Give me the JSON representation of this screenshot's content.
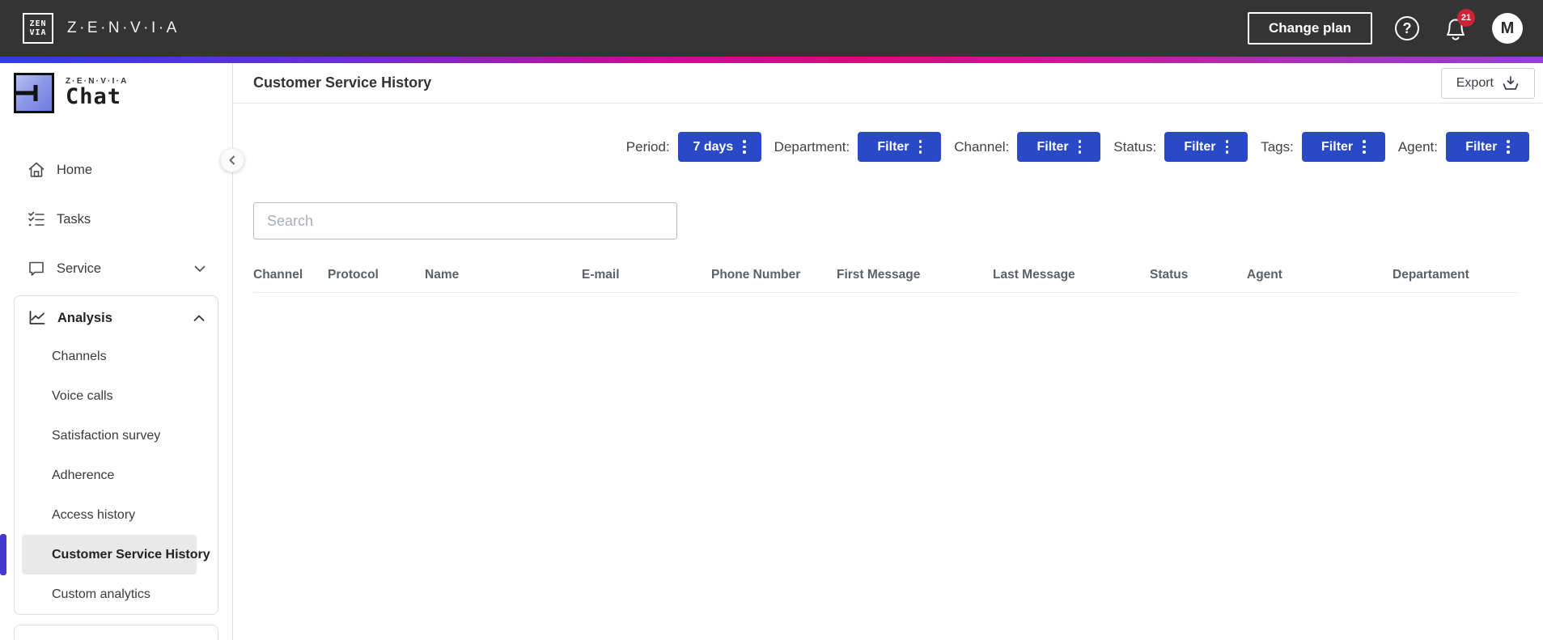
{
  "topbar": {
    "brand": "Z·E·N·V·I·A",
    "logo_glyph_top": "ZEN",
    "logo_glyph_bottom": "VIA",
    "change_plan_label": "Change plan",
    "help_glyph": "?",
    "notification_count": "21",
    "avatar_initial": "M"
  },
  "sidebar": {
    "logo": {
      "brand_small": "Z·E·N·V·I·A",
      "product": "Chat"
    },
    "items": [
      {
        "label": "Home"
      },
      {
        "label": "Tasks"
      },
      {
        "label": "Service"
      }
    ],
    "analysis": {
      "label": "Analysis",
      "items": [
        {
          "label": "Channels"
        },
        {
          "label": "Voice calls"
        },
        {
          "label": "Satisfaction survey"
        },
        {
          "label": "Adherence"
        },
        {
          "label": "Access history"
        },
        {
          "label": "Customer Service History"
        },
        {
          "label": "Custom analytics"
        }
      ],
      "active_item": "Customer Service History"
    }
  },
  "main": {
    "title": "Customer Service History",
    "export_label": "Export",
    "filters": [
      {
        "label": "Period:",
        "value": "7 days"
      },
      {
        "label": "Department:",
        "value": "Filter"
      },
      {
        "label": "Channel:",
        "value": "Filter"
      },
      {
        "label": "Status:",
        "value": "Filter"
      },
      {
        "label": "Tags:",
        "value": "Filter"
      },
      {
        "label": "Agent:",
        "value": "Filter"
      }
    ],
    "search_placeholder": "Search",
    "table": {
      "columns": [
        "Channel",
        "Protocol",
        "Name",
        "E-mail",
        "Phone Number",
        "First Message",
        "Last Message",
        "Status",
        "Agent",
        "Departament"
      ],
      "rows": []
    }
  },
  "colors": {
    "header_bg": "#343434",
    "accent_blue": "#2A49C6",
    "active_indicator": "#4638D1",
    "notification_red": "#CF2233",
    "gradient_stops": [
      "#2F3FD8",
      "#E2067E",
      "#963FD6"
    ]
  }
}
